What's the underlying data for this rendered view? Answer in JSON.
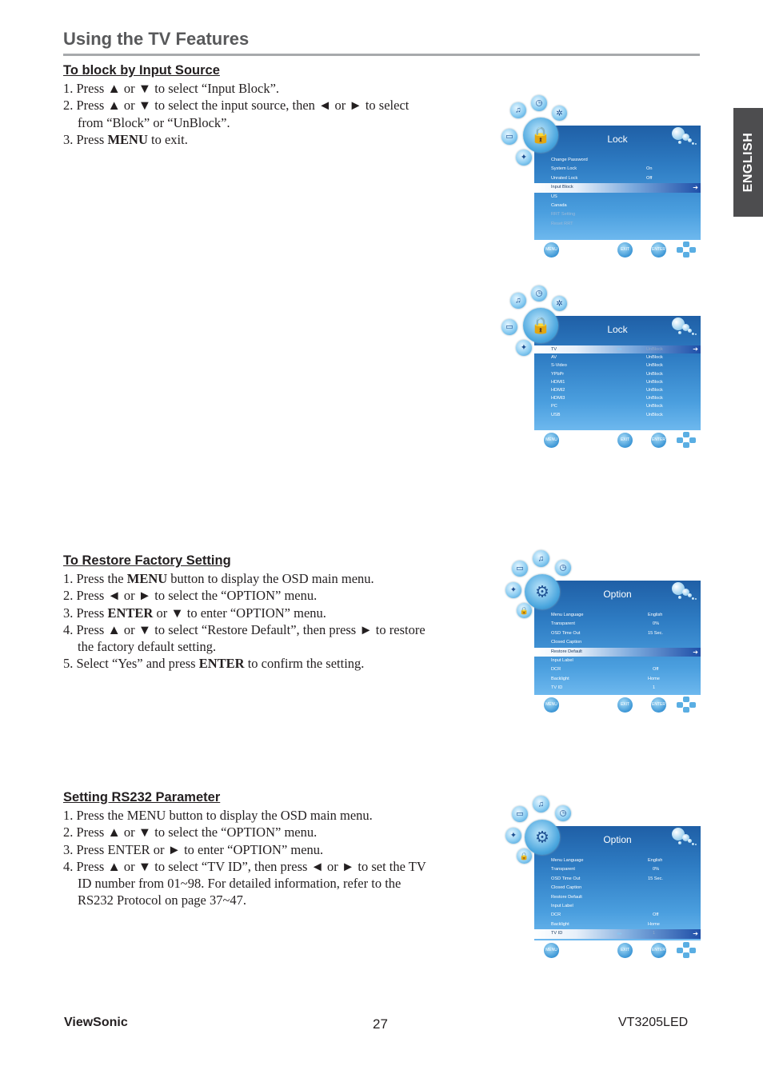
{
  "header": {
    "title": "Using the TV Features"
  },
  "language_tab": "ENGLISH",
  "sections": [
    {
      "heading": "To block by Input Source",
      "steps": [
        {
          "num": "1.",
          "parts": [
            {
              "t": "Press ▲ or ▼ to select “Input Block”."
            }
          ]
        },
        {
          "num": "2.",
          "parts": [
            {
              "t": "Press ▲ or ▼ to select the input source, then ◄ or ► to select from “Block” or “UnBlock”."
            }
          ]
        },
        {
          "num": "3.",
          "parts": [
            {
              "t": "Press "
            },
            {
              "b": "MENU"
            },
            {
              "t": " to exit."
            }
          ]
        }
      ]
    },
    {
      "heading": "To Restore Factory Setting",
      "steps": [
        {
          "num": "1.",
          "parts": [
            {
              "t": "Press the "
            },
            {
              "b": "MENU"
            },
            {
              "t": " button to display the OSD main menu."
            }
          ]
        },
        {
          "num": "2.",
          "parts": [
            {
              "t": "Press ◄ or ► to select the “OPTION” menu."
            }
          ]
        },
        {
          "num": "3.",
          "parts": [
            {
              "t": "Press "
            },
            {
              "b": "ENTER"
            },
            {
              "t": " or ▼ to enter “OPTION” menu."
            }
          ]
        },
        {
          "num": "4.",
          "parts": [
            {
              "t": "Press ▲ or ▼ to select “Restore Default”, then press ► to restore the factory default setting."
            }
          ]
        },
        {
          "num": "5.",
          "parts": [
            {
              "t": "Select “Yes” and press "
            },
            {
              "b": "ENTER"
            },
            {
              "t": " to confirm the setting."
            }
          ]
        }
      ]
    },
    {
      "heading": "Setting RS232 Parameter",
      "steps": [
        {
          "num": "1.",
          "parts": [
            {
              "t": "Press the MENU button to display the OSD main menu."
            }
          ]
        },
        {
          "num": "2.",
          "parts": [
            {
              "t": "Press ▲ or ▼ to select the “OPTION” menu."
            }
          ]
        },
        {
          "num": "3.",
          "parts": [
            {
              "t": "Press ENTER or ► to enter “OPTION” menu."
            }
          ]
        },
        {
          "num": "4.",
          "parts": [
            {
              "t": "Press ▲ or ▼ to select “TV ID”, then press ◄ or ► to set the TV ID number from 01~98. For detailed information, refer to the RS232 Protocol on page 37~47."
            }
          ]
        }
      ]
    }
  ],
  "osd_screens": [
    {
      "title": "Lock",
      "center_icon": "lock-icon",
      "rows": [
        {
          "label": "Change Password",
          "value": ""
        },
        {
          "label": "System Lock",
          "value": "On"
        },
        {
          "label": "Unrated Lock",
          "value": "Off"
        },
        {
          "label": "Input Block",
          "value": "",
          "selected": true,
          "arrow_right": true
        },
        {
          "label": "US",
          "value": ""
        },
        {
          "label": "Canada",
          "value": ""
        },
        {
          "label": "RRT Setting",
          "value": "",
          "dim": true
        },
        {
          "label": "Reset RRT",
          "value": "",
          "dim": true
        }
      ]
    },
    {
      "title": "Lock",
      "center_icon": "lock-icon",
      "rows": [
        {
          "label": "TV",
          "value": "UnBlock",
          "selected": true,
          "arrow_left": true,
          "arrow_right": true
        },
        {
          "label": "AV",
          "value": "UnBlock"
        },
        {
          "label": "S-Video",
          "value": "UnBlock"
        },
        {
          "label": "YPbPr",
          "value": "UnBlock"
        },
        {
          "label": "HDMI1",
          "value": "UnBlock"
        },
        {
          "label": "HDMI2",
          "value": "UnBlock"
        },
        {
          "label": "HDMI3",
          "value": "UnBlock"
        },
        {
          "label": "PC",
          "value": "UnBlock"
        },
        {
          "label": "USB",
          "value": "UnBlock"
        }
      ]
    },
    {
      "title": "Option",
      "center_icon": "gear-icon",
      "rows": [
        {
          "label": "Menu Language",
          "value": "English"
        },
        {
          "label": "Transparent",
          "value": "0%"
        },
        {
          "label": "OSD Time Out",
          "value": "15 Sec."
        },
        {
          "label": "Closed Caption",
          "value": ""
        },
        {
          "label": "Restore Default",
          "value": "",
          "selected": true,
          "arrow_right": true
        },
        {
          "label": "Input Label",
          "value": ""
        },
        {
          "label": "DCR",
          "value": "Off"
        },
        {
          "label": "Backlight",
          "value": "Home"
        },
        {
          "label": "TV ID",
          "value": "1"
        }
      ]
    },
    {
      "title": "Option",
      "center_icon": "gear-icon",
      "rows": [
        {
          "label": "Menu Language",
          "value": "English"
        },
        {
          "label": "Transparent",
          "value": "0%"
        },
        {
          "label": "OSD Time Out",
          "value": "15 Sec."
        },
        {
          "label": "Closed Caption",
          "value": ""
        },
        {
          "label": "Restore Default",
          "value": ""
        },
        {
          "label": "Input Label",
          "value": ""
        },
        {
          "label": "DCR",
          "value": "Off"
        },
        {
          "label": "Backlight",
          "value": "Home"
        },
        {
          "label": "TV ID",
          "value": "1",
          "selected": true,
          "arrow_left": true,
          "arrow_right": true
        }
      ]
    }
  ],
  "osd_footer": {
    "menu": "MENU",
    "exit": "EXIT",
    "enter": "ENTER"
  },
  "footer": {
    "brand": "ViewSonic",
    "page": "27",
    "model": "VT3205LED"
  }
}
